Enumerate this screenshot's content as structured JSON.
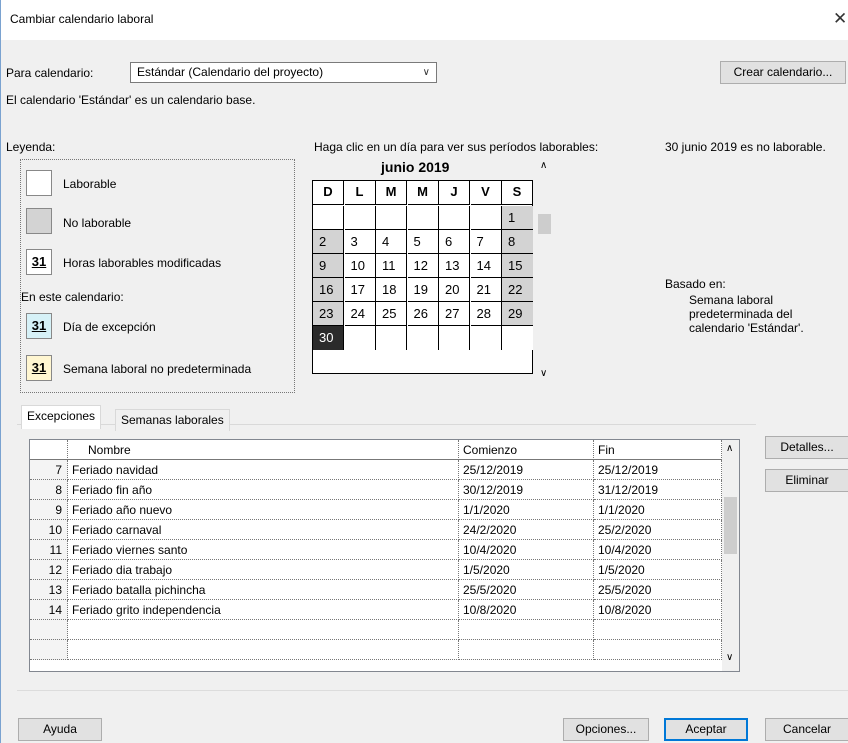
{
  "window": {
    "title": "Cambiar calendario laboral",
    "close_glyph": "✕"
  },
  "top": {
    "for_calendar_label": "Para calendario:",
    "calendar_selected": "Estándar (Calendario del proyecto)",
    "create_calendar_button": "Crear calendario...",
    "base_info": "El calendario 'Estándar' es un calendario base."
  },
  "legend": {
    "title": "Leyenda:",
    "items": [
      {
        "label": "Laborable",
        "swatch": "",
        "color": "#ffffff"
      },
      {
        "label": "No laborable",
        "swatch": "",
        "color": "#d3d3d3"
      },
      {
        "label": "Horas laborables modificadas",
        "swatch": "31",
        "color": "#ffffff"
      }
    ],
    "subtitle": "En este calendario:",
    "calendar_items": [
      {
        "label": "Día de excepción",
        "swatch": "31",
        "color": "#d6f1f7"
      },
      {
        "label": "Semana laboral no predeterminada",
        "swatch": "31",
        "color": "#fff6d1"
      }
    ]
  },
  "calendar": {
    "instruction": "Haga clic en un día para ver sus períodos laborables:",
    "month_label": "junio 2019",
    "weekdays": [
      "D",
      "L",
      "M",
      "M",
      "J",
      "V",
      "S"
    ],
    "weeks": [
      [
        "",
        "",
        "",
        "",
        "",
        "",
        "1"
      ],
      [
        "2",
        "3",
        "4",
        "5",
        "6",
        "7",
        "8"
      ],
      [
        "9",
        "10",
        "11",
        "12",
        "13",
        "14",
        "15"
      ],
      [
        "16",
        "17",
        "18",
        "19",
        "20",
        "21",
        "22"
      ],
      [
        "23",
        "24",
        "25",
        "26",
        "27",
        "28",
        "29"
      ],
      [
        "30",
        "",
        "",
        "",
        "",
        "",
        ""
      ]
    ],
    "selected_day": "30",
    "nonworking_color": "#d3d3d3",
    "selected_color": "#2b2b2b"
  },
  "info": {
    "status": "30 junio 2019 es no laborable.",
    "based_on_label": "Basado en:",
    "based_on_lines": [
      "Semana laboral",
      "predeterminada del",
      "calendario 'Estándar'."
    ]
  },
  "tabs": [
    {
      "label": "Excepciones",
      "active": true
    },
    {
      "label": "Semanas laborales",
      "active": false
    }
  ],
  "exceptions_table": {
    "columns": [
      "",
      "Nombre",
      "Comienzo",
      "Fin"
    ],
    "rows": [
      [
        "7",
        "Feriado navidad",
        "25/12/2019",
        "25/12/2019"
      ],
      [
        "8",
        "Feriado fin año",
        "30/12/2019",
        "31/12/2019"
      ],
      [
        "9",
        "Feriado año nuevo",
        "1/1/2020",
        "1/1/2020"
      ],
      [
        "10",
        "Feriado carnaval",
        "24/2/2020",
        "25/2/2020"
      ],
      [
        "11",
        "Feriado viernes santo",
        "10/4/2020",
        "10/4/2020"
      ],
      [
        "12",
        "Feriado dia trabajo",
        "1/5/2020",
        "1/5/2020"
      ],
      [
        "13",
        "Feriado batalla pichincha",
        "25/5/2020",
        "25/5/2020"
      ],
      [
        "14",
        "Feriado grito independencia",
        "10/8/2020",
        "10/8/2020"
      ],
      [
        "",
        "",
        "",
        ""
      ],
      [
        "",
        "",
        "",
        ""
      ]
    ]
  },
  "side_buttons": {
    "details": "Detalles...",
    "delete": "Eliminar"
  },
  "footer": {
    "help": "Ayuda",
    "options": "Opciones...",
    "accept": "Aceptar",
    "cancel": "Cancelar"
  }
}
